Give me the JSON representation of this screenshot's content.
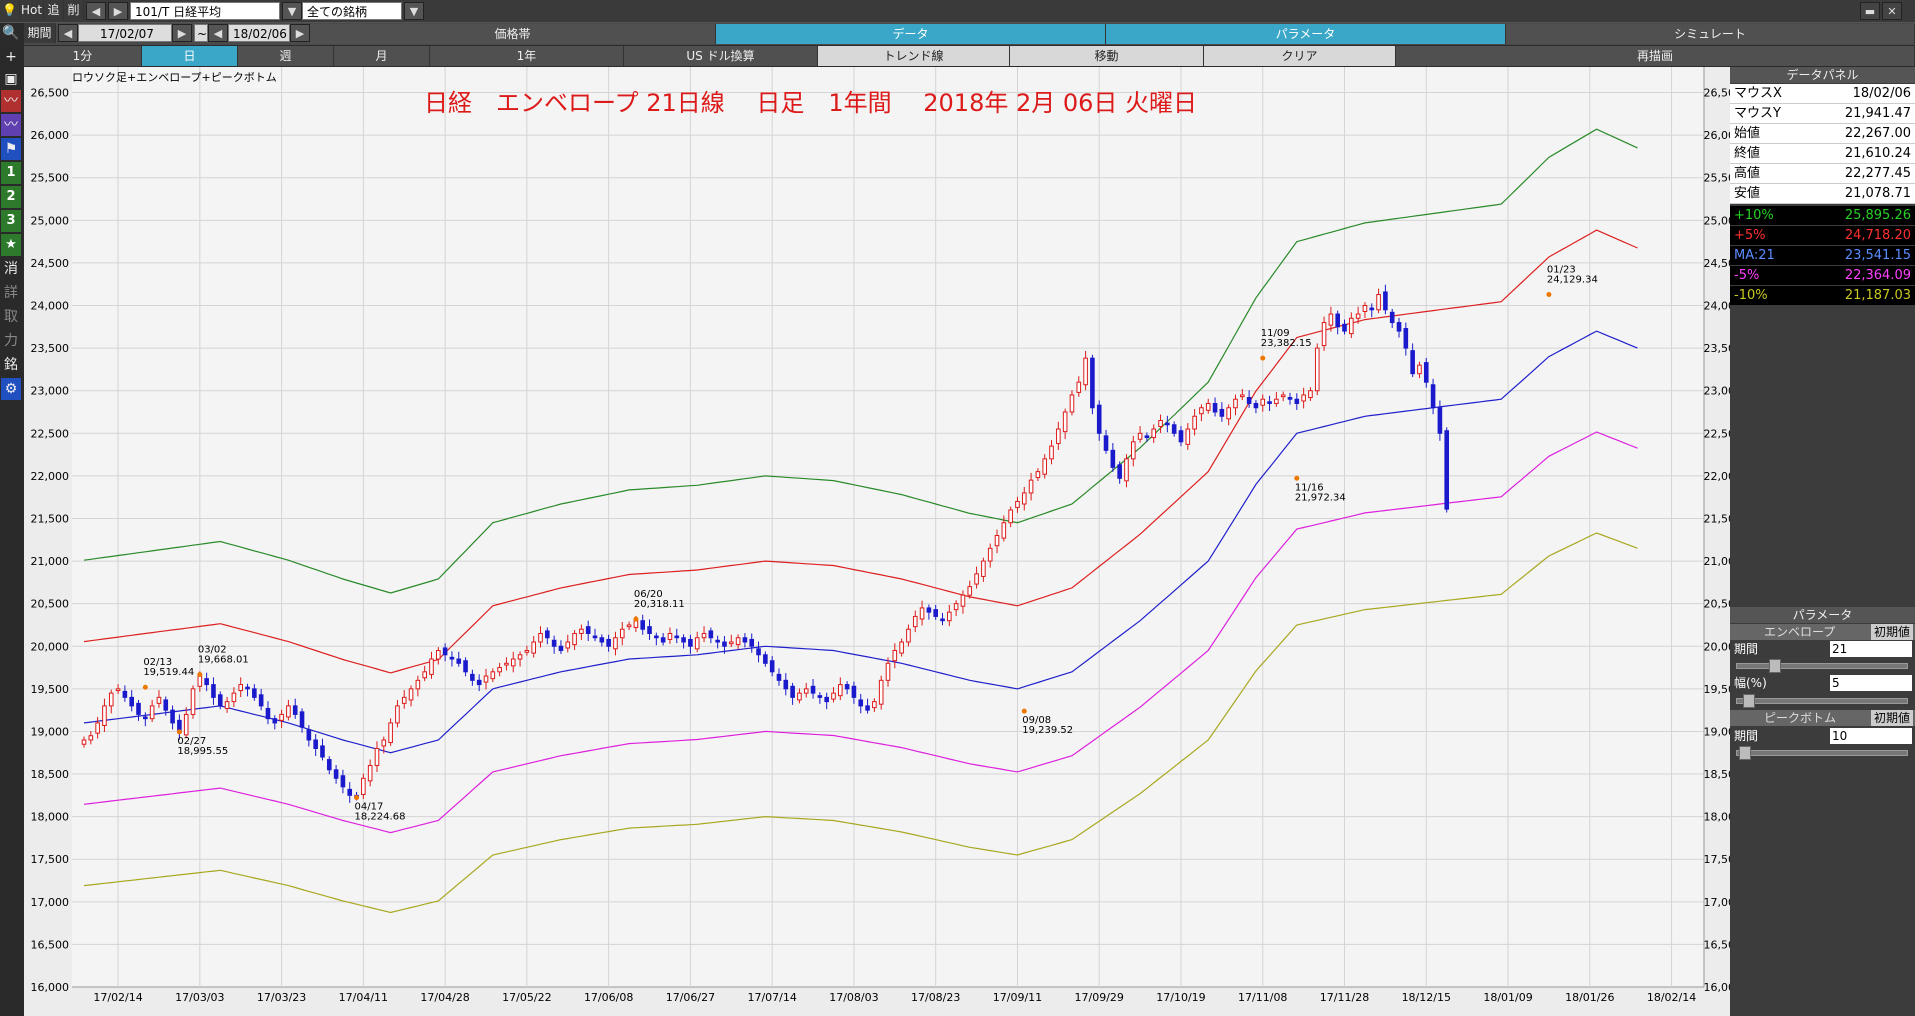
{
  "toolbar": {
    "hot": "Hot",
    "add": "追",
    "del": "削",
    "symbol": "101/T 日経平均",
    "universe": "全ての銘柄",
    "period_label": "期間",
    "date_from": "17/02/07",
    "tilde": "~",
    "date_to": "18/02/06",
    "tabs": [
      "価格帯",
      "データ",
      "パラメータ",
      "シミュレート"
    ],
    "periods": [
      "1分",
      "日",
      "週",
      "月",
      "1年",
      "US ドル換算",
      "トレンド線",
      "移動",
      "クリア",
      "再描画"
    ]
  },
  "left_icons": [
    "search-icon",
    "plus-icon",
    "camera-icon",
    "line-chart-icon",
    "line-chart2-icon",
    "flag-icon",
    "1",
    "2",
    "3",
    "star-icon",
    "消",
    "詳",
    "取",
    "力",
    "銘",
    "gear-icon"
  ],
  "chart": {
    "subtitle": "ロウソク足+エンベロープ+ピークボトム",
    "title": "日経　エンベロープ 21日線　 日足　1年間　 2018年 2月 06日 火曜日"
  },
  "panel": {
    "header": "データパネル",
    "mouse": [
      [
        "マウスX",
        "18/02/06"
      ],
      [
        "マウスY",
        "21,941.47"
      ]
    ],
    "ohlc": [
      [
        "始値",
        "22,267.00"
      ],
      [
        "終値",
        "21,610.24"
      ],
      [
        "高値",
        "22,277.45"
      ],
      [
        "安値",
        "21,078.71"
      ]
    ],
    "env": [
      {
        "label": "+10%",
        "value": "25,895.26",
        "color": "#28d028"
      },
      {
        "label": "+5%",
        "value": "24,718.20",
        "color": "#ff3030"
      },
      {
        "label": "MA:21",
        "value": "23,541.15",
        "color": "#5a8cff"
      },
      {
        "label": "-5%",
        "value": "22,364.09",
        "color": "#ff40ff"
      },
      {
        "label": "-10%",
        "value": "21,187.03",
        "color": "#c8c820"
      }
    ],
    "param_header": "パラメータ",
    "env_header": "エンベロープ",
    "reset": "初期値",
    "period_label": "期間",
    "period_value": "21",
    "width_label": "幅(%)",
    "width_value": "5",
    "pb_header": "ピークボトム",
    "pb_period_label": "期間",
    "pb_period_value": "10"
  },
  "chart_data": {
    "type": "candlestick",
    "ylim": [
      16000,
      26800
    ],
    "y_ticks": [
      16000,
      16500,
      17000,
      17500,
      18000,
      18500,
      19000,
      19500,
      20000,
      20500,
      21000,
      21500,
      22000,
      22500,
      23000,
      23500,
      24000,
      24500,
      25000,
      25500,
      26000,
      26500
    ],
    "x_ticks": [
      {
        "label": "17/02/14",
        "i": 5
      },
      {
        "label": "17/03/03",
        "i": 17
      },
      {
        "label": "17/03/23",
        "i": 29
      },
      {
        "label": "17/04/11",
        "i": 41
      },
      {
        "label": "17/04/28",
        "i": 53
      },
      {
        "label": "17/05/22",
        "i": 65
      },
      {
        "label": "17/06/08",
        "i": 77
      },
      {
        "label": "17/06/27",
        "i": 89
      },
      {
        "label": "17/07/14",
        "i": 101
      },
      {
        "label": "17/08/03",
        "i": 113
      },
      {
        "label": "17/08/23",
        "i": 125
      },
      {
        "label": "17/09/11",
        "i": 137
      },
      {
        "label": "17/09/29",
        "i": 149
      },
      {
        "label": "17/10/19",
        "i": 161
      },
      {
        "label": "17/11/08",
        "i": 173
      },
      {
        "label": "17/11/28",
        "i": 185
      },
      {
        "label": "18/12/15",
        "i": 197
      },
      {
        "label": "18/01/09",
        "i": 209
      },
      {
        "label": "18/01/26",
        "i": 221
      },
      {
        "label": "18/02/14",
        "i": 233
      }
    ],
    "ma_points": [
      [
        0,
        19100
      ],
      [
        10,
        19200
      ],
      [
        20,
        19300
      ],
      [
        30,
        19100
      ],
      [
        38,
        18900
      ],
      [
        45,
        18750
      ],
      [
        52,
        18900
      ],
      [
        60,
        19500
      ],
      [
        70,
        19700
      ],
      [
        80,
        19850
      ],
      [
        90,
        19900
      ],
      [
        100,
        20000
      ],
      [
        110,
        19950
      ],
      [
        120,
        19800
      ],
      [
        130,
        19600
      ],
      [
        137,
        19500
      ],
      [
        145,
        19700
      ],
      [
        155,
        20300
      ],
      [
        165,
        21000
      ],
      [
        172,
        21900
      ],
      [
        178,
        22500
      ],
      [
        188,
        22700
      ],
      [
        198,
        22800
      ],
      [
        208,
        22900
      ],
      [
        215,
        23400
      ],
      [
        222,
        23700
      ],
      [
        228,
        23500
      ]
    ],
    "envelopes": [
      {
        "name": "+10%",
        "pct": 10,
        "color": "#2a8a2a"
      },
      {
        "name": "+5%",
        "pct": 5,
        "color": "#dd2020"
      },
      {
        "name": "MA:21",
        "pct": 0,
        "color": "#2020cc"
      },
      {
        "name": "-5%",
        "pct": -5,
        "color": "#dd20dd"
      },
      {
        "name": "-10%",
        "pct": -10,
        "color": "#a8a820"
      }
    ],
    "closes": [
      18900,
      18950,
      19100,
      19300,
      19450,
      19500,
      19400,
      19300,
      19200,
      19150,
      19300,
      19400,
      19250,
      19100,
      18990,
      19200,
      19500,
      19650,
      19550,
      19400,
      19300,
      19350,
      19450,
      19550,
      19500,
      19400,
      19300,
      19150,
      19100,
      19200,
      19300,
      19200,
      19050,
      18900,
      18800,
      18700,
      18550,
      18450,
      18350,
      18250,
      18230,
      18450,
      18600,
      18800,
      18900,
      19100,
      19300,
      19400,
      19500,
      19600,
      19700,
      19850,
      19950,
      19900,
      19850,
      19800,
      19700,
      19600,
      19550,
      19650,
      19700,
      19750,
      19800,
      19850,
      19900,
      19950,
      20050,
      20150,
      20100,
      20000,
      19950,
      20050,
      20150,
      20200,
      20150,
      20100,
      20050,
      20000,
      20100,
      20200,
      20250,
      20300,
      20200,
      20150,
      20100,
      20050,
      20150,
      20100,
      20050,
      20000,
      20100,
      20150,
      20100,
      20050,
      20000,
      20050,
      20100,
      20050,
      20000,
      19900,
      19800,
      19700,
      19600,
      19500,
      19400,
      19450,
      19500,
      19450,
      19400,
      19350,
      19450,
      19550,
      19500,
      19400,
      19300,
      19250,
      19350,
      19600,
      19800,
      19950,
      20050,
      20200,
      20350,
      20450,
      20400,
      20350,
      20300,
      20400,
      20500,
      20600,
      20700,
      20850,
      21000,
      21150,
      21300,
      21450,
      21600,
      21700,
      21800,
      21950,
      22050,
      22200,
      22350,
      22550,
      22750,
      22950,
      23100,
      23382,
      22800,
      22500,
      22300,
      22100,
      21972,
      22200,
      22400,
      22500,
      22450,
      22550,
      22650,
      22600,
      22500,
      22400,
      22550,
      22700,
      22800,
      22850,
      22750,
      22700,
      22800,
      22900,
      22950,
      22850,
      22800,
      22900,
      22850,
      22900,
      22950,
      22900,
      22850,
      22950,
      23000,
      23500,
      23800,
      23900,
      23750,
      23700,
      23850,
      23900,
      24000,
      23950,
      24129,
      23950,
      23800,
      23700,
      23500,
      23200,
      23300,
      23100,
      22800,
      22500,
      21610
    ],
    "annotations": [
      {
        "date": "02/13",
        "value": "19,519.44",
        "i": 9,
        "y": 19519,
        "dir": "up"
      },
      {
        "date": "03/02",
        "value": "19,668.01",
        "i": 17,
        "y": 19668,
        "dir": "up"
      },
      {
        "date": "02/27",
        "value": "18,995.55",
        "i": 14,
        "y": 18995,
        "dir": "down"
      },
      {
        "date": "04/17",
        "value": "18,224.68",
        "i": 40,
        "y": 18224,
        "dir": "down"
      },
      {
        "date": "06/20",
        "value": "20,318.11",
        "i": 81,
        "y": 20318,
        "dir": "up"
      },
      {
        "date": "09/08",
        "value": "19,239.52",
        "i": 138,
        "y": 19239,
        "dir": "down"
      },
      {
        "date": "11/09",
        "value": "23,382.15",
        "i": 173,
        "y": 23382,
        "dir": "up"
      },
      {
        "date": "11/16",
        "value": "21,972.34",
        "i": 178,
        "y": 21972,
        "dir": "down"
      },
      {
        "date": "01/23",
        "value": "24,129.34",
        "i": 215,
        "y": 24129,
        "dir": "up"
      }
    ]
  }
}
